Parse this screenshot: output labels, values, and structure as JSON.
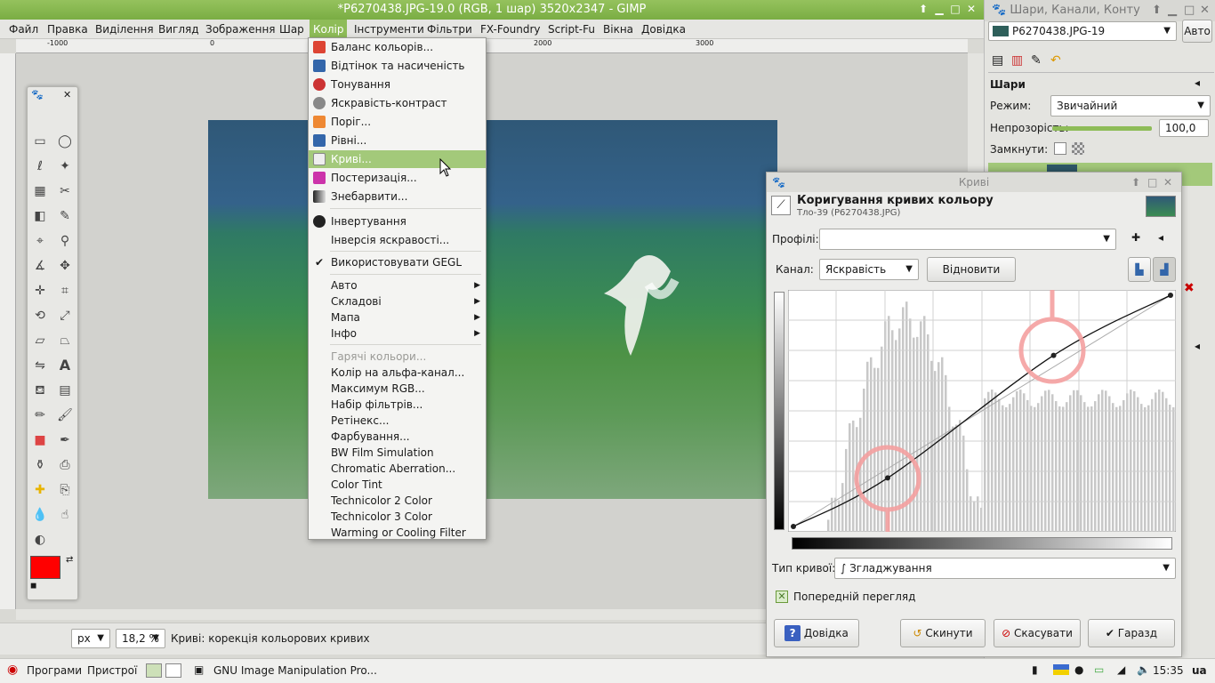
{
  "window": {
    "title": "*P6270438.JPG-19.0 (RGB, 1 шар) 3520x2347 - GIMP"
  },
  "menubar": [
    "Файл",
    "Правка",
    "Виділення",
    "Вигляд",
    "Зображення",
    "Шар",
    "Колір",
    "Інструменти",
    "Фільтри",
    "FX-Foundry",
    "Script-Fu",
    "Вікна",
    "Довідка"
  ],
  "ruler": {
    "m1": "-1000",
    "m0": "0",
    "m1000": "1000",
    "m2000": "2000",
    "m3000": "3000"
  },
  "color_menu": {
    "items": [
      {
        "label": "Баланс кольорів...",
        "icon_color": "#d43"
      },
      {
        "label": "Відтінок та насиченість",
        "icon_color": "#36a"
      },
      {
        "label": "Тонування",
        "icon_color": "#c33"
      },
      {
        "label": "Яскравість-контраст",
        "icon_color": "#888"
      },
      {
        "label": "Поріг...",
        "icon_color": "#e83"
      },
      {
        "label": "Рівні...",
        "icon_color": "#36a"
      },
      {
        "label": "Криві...",
        "icon_color": "#eee"
      },
      {
        "label": "Постеризація...",
        "icon_color": "#c3a"
      },
      {
        "label": "Знебарвити...",
        "icon_color": "#555"
      },
      {
        "label": "Інвертування",
        "icon_color": "#222"
      },
      {
        "label": "Інверсія яскравості..."
      },
      {
        "label": "Використовувати GEGL",
        "check": "✔"
      },
      {
        "label": "Авто",
        "arrow": "▶"
      },
      {
        "label": "Складові",
        "arrow": "▶"
      },
      {
        "label": "Мапа",
        "arrow": "▶"
      },
      {
        "label": "Інфо",
        "arrow": "▶"
      },
      {
        "label": "Гарячі кольори..."
      },
      {
        "label": "Колір на альфа-канал..."
      },
      {
        "label": "Максимум RGB..."
      },
      {
        "label": "Набір фільтрів..."
      },
      {
        "label": "Ретінекс..."
      },
      {
        "label": "Фарбування..."
      },
      {
        "label": "BW Film Simulation"
      },
      {
        "label": "Chromatic Aberration..."
      },
      {
        "label": "Color Tint"
      },
      {
        "label": "Technicolor 2 Color"
      },
      {
        "label": "Technicolor 3 Color"
      },
      {
        "label": "Warming or Cooling Filter"
      }
    ]
  },
  "status": {
    "unit": "px",
    "zoom": "18,2 %",
    "message": "Криві: корекція кольорових кривих"
  },
  "dock": {
    "title": "Шари, Канали, Конту",
    "image_select": "P6270438.JPG-19",
    "auto_button": "Авто",
    "layers_label": "Шари",
    "mode_label": "Режим:",
    "mode_value": "Звичайний",
    "opacity_label": "Непрозорість:",
    "opacity_value": "100,0",
    "lock_label": "Замкнути:"
  },
  "curves": {
    "title": "Криві",
    "heading": "Коригування кривих кольору",
    "subheading": "Тло-39 (P6270438.JPG)",
    "profiles_label": "Профілі:",
    "channel_label": "Канал:",
    "channel_value": "Яскравість",
    "reset_channel": "Відновити канал",
    "curve_type_label": "Тип кривої:",
    "curve_type_value": "Згладжування",
    "preview_label": "Попередній перегляд",
    "help_button": "Довідка",
    "reset_button": "Скинути",
    "cancel_button": "Скасувати",
    "ok_button": "Гаразд",
    "curve_points": [
      [
        0,
        0
      ],
      [
        0.25,
        0.21
      ],
      [
        0.69,
        0.74
      ],
      [
        1,
        1
      ]
    ]
  },
  "taskbar": {
    "apps": "Програми",
    "devices": "Пристрої",
    "task": "GNU Image Manipulation Pro...",
    "clock": "15:35",
    "lang": "ua"
  }
}
